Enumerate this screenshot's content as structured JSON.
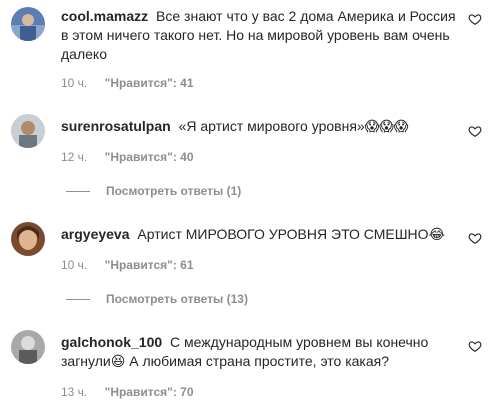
{
  "comments": [
    {
      "username": "cool.mamazz",
      "text": "Все знают что у вас 2 дома Америка и Россия в этом ничего такого нет. Но на мировой уровень вам очень далеко",
      "time": "10 ч.",
      "likes": "\"Нравится\": 41"
    },
    {
      "username": "surenrosatulpan",
      "text": "«Я артист мирового уровня»",
      "emojis": "😱😱😱",
      "time": "12 ч.",
      "likes": "\"Нравится\": 40",
      "replies": "Посмотреть ответы (1)"
    },
    {
      "username": "argyeyeva",
      "text": "Артист МИРОВОГО УРОВНЯ ЭТО СМЕШНО",
      "emojis": "😂",
      "time": "10 ч.",
      "likes": "\"Нравится\": 61",
      "replies": "Посмотреть ответы (13)"
    },
    {
      "username": "galchonok_100",
      "text_before": "С международным уровнем вы конечно загнули",
      "emojis": "😆",
      "text_after": " А любимая страна простите, это какая?",
      "time": "13 ч.",
      "likes": "\"Нравится\": 70"
    }
  ],
  "icons": {
    "like": "heart-outline-icon"
  }
}
